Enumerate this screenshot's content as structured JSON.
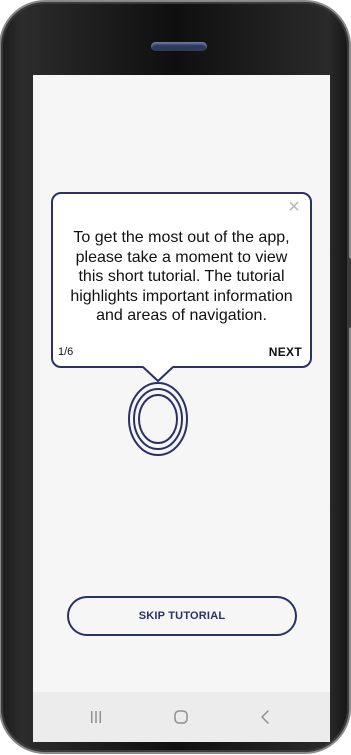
{
  "tooltip": {
    "message": "To get the most out of the app, please take a moment to view this short tutorial. The tutorial highlights important information and areas of navigation.",
    "step": "1/6",
    "next_label": "NEXT",
    "close_glyph": "×"
  },
  "skip_button": {
    "label": "SKIP TUTORIAL"
  },
  "nav_bar": {
    "recent_apps_icon": "recent-apps-icon",
    "home_icon": "home-icon",
    "back_icon": "back-icon"
  },
  "colors": {
    "accent": "#2b3163",
    "screen_background": "#f6f6f6",
    "nav_bar_background": "#ececec",
    "nav_icon": "#8f8f8f"
  }
}
